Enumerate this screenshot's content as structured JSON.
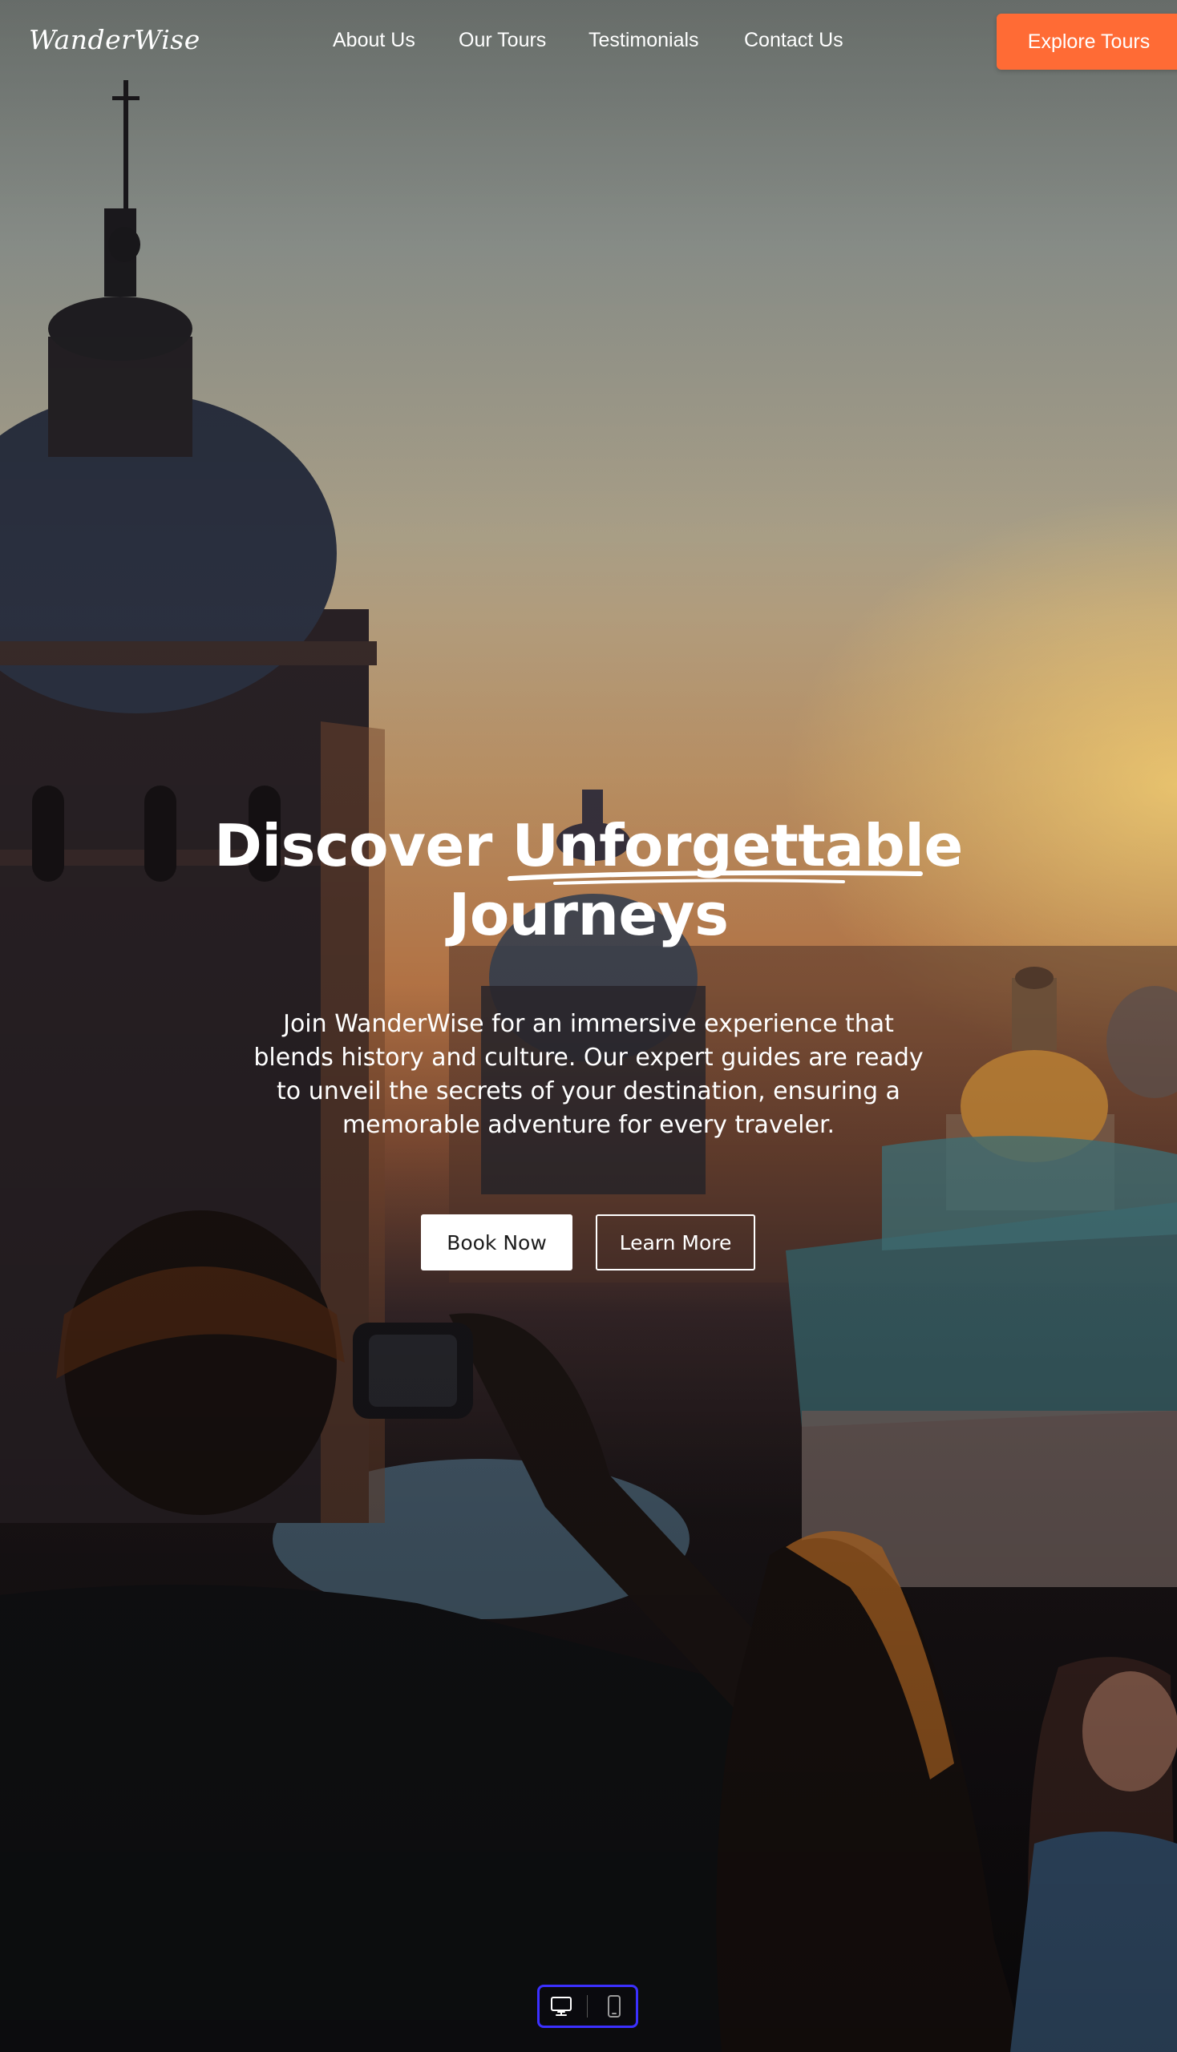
{
  "brand": {
    "logo": "WanderWise"
  },
  "nav": {
    "links": [
      {
        "label": "About Us"
      },
      {
        "label": "Our Tours"
      },
      {
        "label": "Testimonials"
      },
      {
        "label": "Contact Us"
      }
    ],
    "cta_label": "Explore Tours",
    "cta_color": "#ff6b35"
  },
  "hero": {
    "headline_part1": "Discover ",
    "headline_highlight": "Unforgettable",
    "headline_line2": "Journeys",
    "subtitle": "Join WanderWise for an immersive experience that blends history and culture. Our expert guides are ready to unveil the secrets of your destination, ensuring a memorable adventure for every traveler.",
    "primary_button": "Book Now",
    "secondary_button": "Learn More",
    "background_image": "sunset-city-domes-tourist-photo"
  },
  "device_switcher": {
    "options": [
      {
        "icon": "desktop-icon",
        "selected": true
      },
      {
        "icon": "mobile-icon",
        "selected": false
      }
    ],
    "accent": "#3b30ff"
  }
}
